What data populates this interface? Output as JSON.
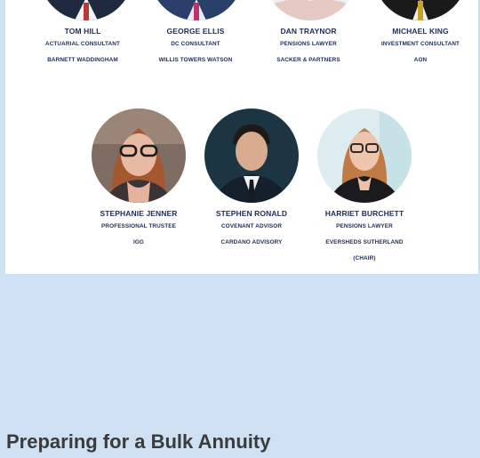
{
  "team_row_1": [
    {
      "name": "TOM HILL",
      "role": "ACTUARIAL CONSULTANT",
      "company": "BARNETT WADDINGHAM"
    },
    {
      "name": "GEORGE ELLIS",
      "role": "DC CONSULTANT",
      "company": "WILLIS TOWERS WATSON"
    },
    {
      "name": "DAN TRAYNOR",
      "role": "PENSIONS LAWYER",
      "company": "SACKER & PARTNERS"
    },
    {
      "name": "MICHAEL KING",
      "role": "INVESTMENT CONSULTANT",
      "company": "AON"
    }
  ],
  "team_row_2": [
    {
      "name": "STEPHANIE JENNER",
      "role": "PROFESSIONAL TRUSTEE",
      "company": "IGG"
    },
    {
      "name": "STEPHEN RONALD",
      "role": "COVENANT ADVISOR",
      "company": "CARDANO ADVISORY"
    },
    {
      "name": "HARRIET BURCHETT",
      "role": "PENSIONS LAWYER",
      "company": "EVERSHEDS SUTHERLAND",
      "note": "(CHAIR)"
    }
  ],
  "section_heading": "Preparing for a Bulk Annuity",
  "colors": {
    "page_bg": "#cfe0f3",
    "card_bg": "#ffffff",
    "name_text": "#1f2d57",
    "heading_text": "#3b3b3b"
  }
}
